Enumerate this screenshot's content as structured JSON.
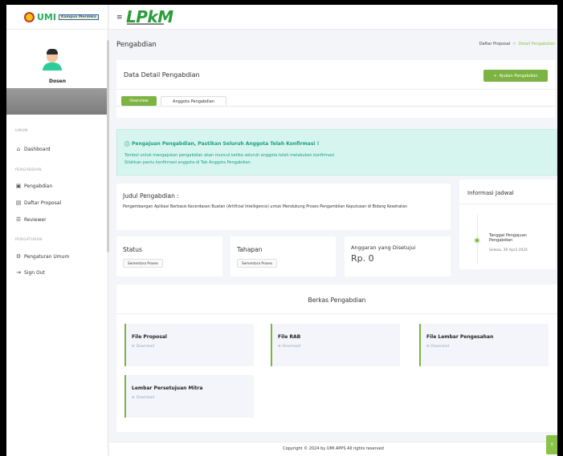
{
  "brand": {
    "name": "UMI",
    "tag": "Kampus Merdeka"
  },
  "app_logo": "LPkM",
  "user": {
    "role": "Dosen"
  },
  "sidebar": {
    "sections": [
      {
        "title": "UMUM"
      },
      {
        "title": "PENGABDIAN"
      },
      {
        "title": "PENGATURAN"
      }
    ],
    "items": [
      {
        "label": "Dashboard",
        "icon": "home-icon"
      },
      {
        "label": "Pengabdian",
        "icon": "folder-icon"
      },
      {
        "label": "Daftar Proposal",
        "icon": "document-icon"
      },
      {
        "label": "Reviewer",
        "icon": "list-icon"
      },
      {
        "label": "Pengaturan Umum",
        "icon": "gear-icon"
      },
      {
        "label": "Sign Out",
        "icon": "logout-icon"
      }
    ]
  },
  "header": {
    "title": "Pengabdian",
    "breadcrumb": [
      "Daftar Proposal",
      "Detail Pengabdian"
    ],
    "separator": ">"
  },
  "detail": {
    "title": "Data Detail Pengabdian",
    "ajukan_label": "Ajukan Pengabdian",
    "tabs": [
      "Overview",
      "Anggota Pengabdian"
    ]
  },
  "alert": {
    "title": "Pengajuan Pengabdian, Pastikan Seluruh Anggota Telah Konfirmasi !",
    "line1": "Tombol untuk mengajukan pengabdian akan muncul ketika seluruh anggota telah melakukan konfirmasi",
    "line2": "Silahkan pantu konfirmasi anggota di Tab Anggota Pengabdian"
  },
  "judul": {
    "title": "Judul Pengabdian :",
    "text": "Pengembangan Aplikasi Berbasis Kecerdasan Buatan (Artificial Intelligence) untuk Mendukung Proses Pengambilan Keputusan di Bidang Kesehatan"
  },
  "jadwal": {
    "title": "Informasi Jadwal",
    "event_label": "Tanggal Pengajuan Pengabdian",
    "event_date": "Selasa, 30 April 2024"
  },
  "status": {
    "label": "Status",
    "value": "Sementara Proses"
  },
  "tahapan": {
    "label": "Tahapan",
    "value": "Sementara Proses"
  },
  "anggaran": {
    "label": "Anggaran yang Disetujui",
    "value": "Rp. 0"
  },
  "berkas": {
    "title": "Berkas Pengabdian",
    "download_label": "Download",
    "files": [
      {
        "name": "File Proposal"
      },
      {
        "name": "File RAB"
      },
      {
        "name": "File Lembar Pengesahan"
      },
      {
        "name": "Lembar Persetujuan Mitra"
      }
    ]
  },
  "footer": {
    "text": "Copyright © 2024 by UMI APPS All rights reserved"
  },
  "back_to_top": "↑",
  "colors": {
    "accent": "#7cb342",
    "alert_bg": "#d6f5ee",
    "alert_text": "#1aa07e"
  }
}
